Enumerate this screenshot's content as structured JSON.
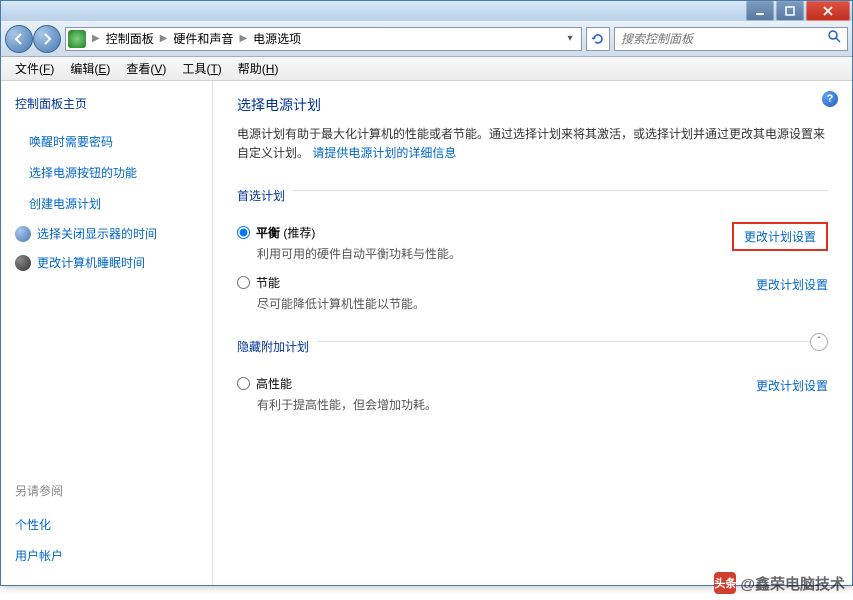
{
  "breadcrumb": {
    "root": "控制面板",
    "lvl1": "硬件和声音",
    "lvl2": "电源选项"
  },
  "search": {
    "placeholder": "搜索控制面板"
  },
  "menu": {
    "file": "文件",
    "file_k": "F",
    "edit": "编辑",
    "edit_k": "E",
    "view": "查看",
    "view_k": "V",
    "tools": "工具",
    "tools_k": "T",
    "help": "帮助",
    "help_k": "H"
  },
  "sidebar": {
    "home": "控制面板主页",
    "links": [
      "唤醒时需要密码",
      "选择电源按钮的功能",
      "创建电源计划"
    ],
    "display_off": "选择关闭显示器的时间",
    "sleep": "更改计算机睡眠时间",
    "see_also": "另请参阅",
    "personalize": "个性化",
    "accounts": "用户帐户"
  },
  "main": {
    "title": "选择电源计划",
    "desc1": "电源计划有助于最大化计算机的性能或者节能。通过选择计划来将其激活，或选择计划并通过更改其电源设置来自定义计划。",
    "info_link": "请提供电源计划的详细信息",
    "preferred": "首选计划",
    "hidden": "隐藏附加计划",
    "plans": {
      "balanced": {
        "name": "平衡",
        "rec": "(推荐)",
        "desc": "利用可用的硬件自动平衡功耗与性能。"
      },
      "saver": {
        "name": "节能",
        "desc": "尽可能降低计算机性能以节能。"
      },
      "high": {
        "name": "高性能",
        "desc": "有利于提高性能，但会增加功耗。"
      }
    },
    "change_link": "更改计划设置"
  },
  "watermark": {
    "logo": "头条",
    "text": "@鑫荣电脑技术"
  }
}
